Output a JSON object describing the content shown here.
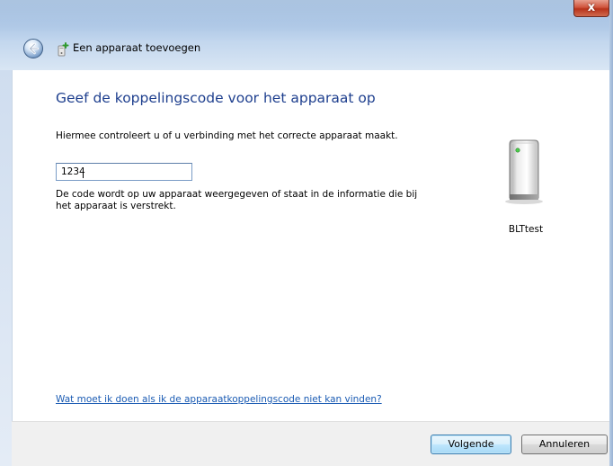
{
  "window": {
    "title": "Een apparaat toevoegen",
    "close_glyph": "x"
  },
  "icons": {
    "back": "back-arrow-icon",
    "wizard": "add-device-icon",
    "device": "device-tower-icon",
    "close": "close-icon"
  },
  "main": {
    "heading": "Geef de koppelingscode voor het apparaat op",
    "instruction": "Hiermee controleert u of u verbinding met het correcte apparaat maakt.",
    "code_input": {
      "value": "1234",
      "placeholder": ""
    },
    "help_text": "De code wordt op uw apparaat weergegeven of staat in de informatie die bij het apparaat is verstrekt.",
    "help_link": "Wat moet ik doen als ik de apparaatkoppelingscode niet kan vinden?"
  },
  "device": {
    "name": "BLTtest"
  },
  "footer": {
    "next_label": "Volgende",
    "cancel_label": "Annuleren"
  },
  "colors": {
    "heading": "#1e3f8e",
    "link": "#1a5bb3",
    "chrome": "#a9c4e4",
    "close": "#c8462d"
  }
}
